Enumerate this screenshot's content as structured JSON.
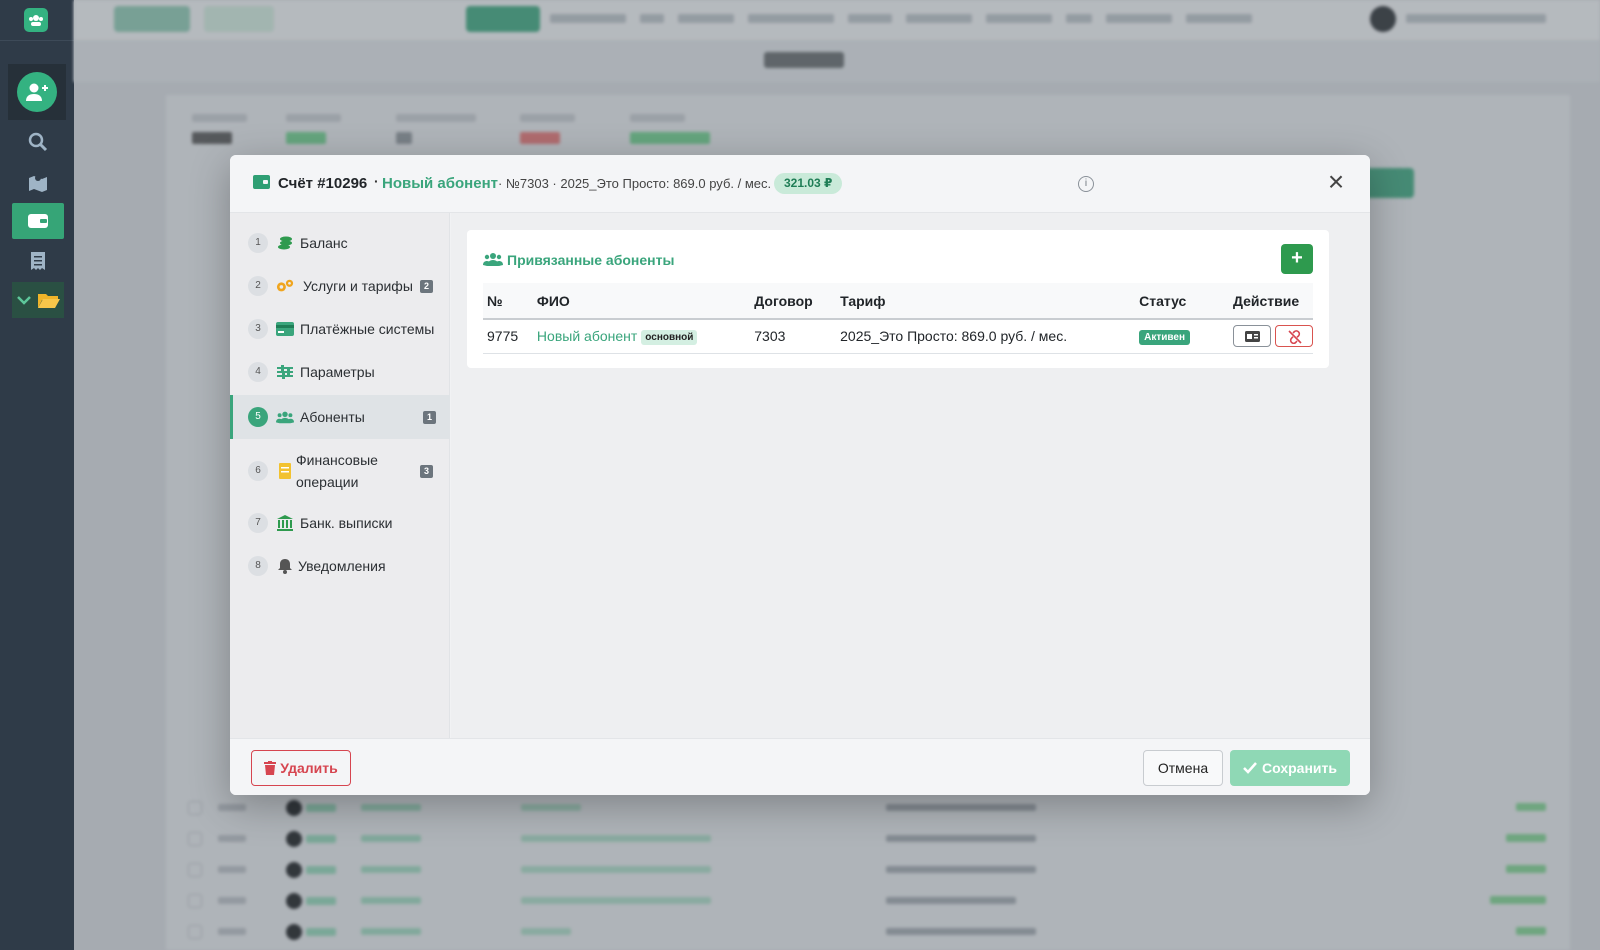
{
  "modal": {
    "title": "Счёт #10296",
    "separator": "·",
    "subscriber_name": "Новый абонент",
    "meta": "· №7303 · 2025_Это Просто: 869.0 руб. / мес.",
    "balance": "321.03 ₽",
    "info_symbol": "i",
    "close_symbol": "×"
  },
  "nav": [
    {
      "num": "1",
      "label": "Баланс",
      "badge": "",
      "icon": "coins-icon"
    },
    {
      "num": "2",
      "label": "Услуги и тарифы",
      "badge": "2",
      "icon": "gears-icon"
    },
    {
      "num": "3",
      "label": "Платёжные системы",
      "badge": "",
      "icon": "credit-card-icon"
    },
    {
      "num": "4",
      "label": "Параметры",
      "badge": "",
      "icon": "sliders-icon"
    },
    {
      "num": "5",
      "label": "Абоненты",
      "badge": "1",
      "icon": "users-icon",
      "active": true
    },
    {
      "num": "6",
      "label": "Финансовые операции",
      "badge": "3",
      "icon": "ledger-icon"
    },
    {
      "num": "7",
      "label": "Банк. выписки",
      "badge": "",
      "icon": "bank-icon"
    },
    {
      "num": "8",
      "label": "Уведомления",
      "badge": "",
      "icon": "bell-icon"
    }
  ],
  "card": {
    "title": "Привязанные абоненты",
    "add_symbol": "+",
    "columns": [
      "№",
      "ФИО",
      "Договор",
      "Тариф",
      "Статус",
      "Действие"
    ],
    "rows": [
      {
        "id": "9775",
        "name": "Новый абонент",
        "tag": "основной",
        "contract": "7303",
        "tariff": "2025_Это Просто: 869.0 руб. / мес.",
        "status": "Активен"
      }
    ]
  },
  "footer": {
    "delete_label": "Удалить",
    "cancel_label": "Отмена",
    "save_label": "Сохранить"
  },
  "colors": {
    "accent": "#3aa57c",
    "sidebar": "#2f3b48",
    "danger": "#d64550"
  }
}
